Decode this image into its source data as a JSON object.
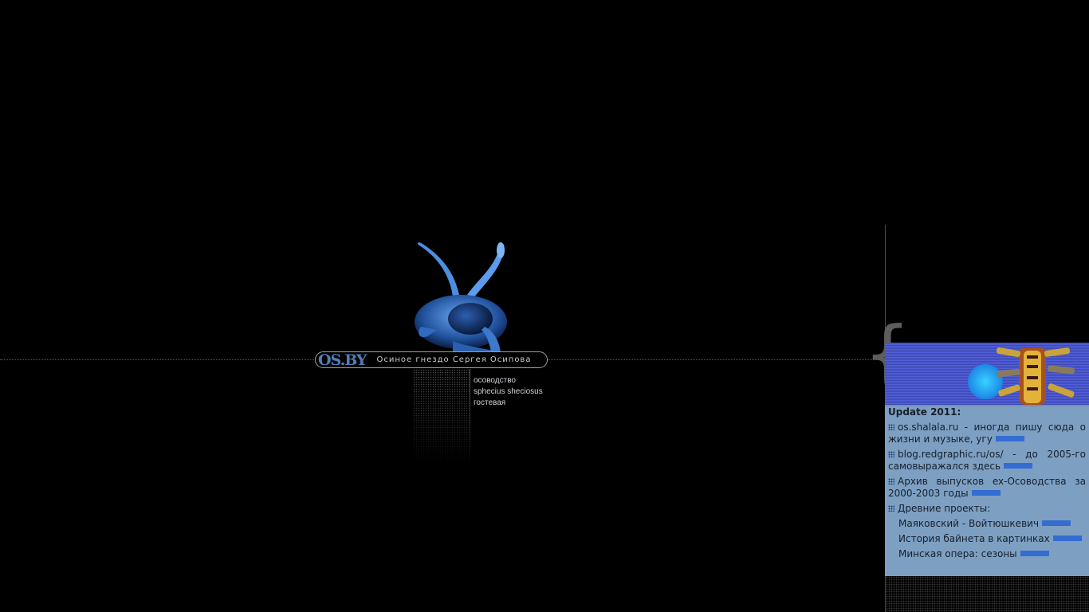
{
  "header": {
    "logo": "OS.BY",
    "tagline": "Осиное гнездо Сергея Осипова"
  },
  "menu": {
    "items": [
      {
        "label": "осоводство"
      },
      {
        "label": "sphecius sheciosus"
      },
      {
        "label": "гостевая"
      }
    ]
  },
  "sidebar": {
    "title": "Update 2011:",
    "entries": [
      {
        "text": "os.shalala.ru - иногда пишу сюда о жизни и музыке, угу"
      },
      {
        "text": "blog.redgraphic.ru/os/ - до 2005-го самовыражался здесь"
      },
      {
        "text": "Архив выпусков ex-Осоводства за 2000-2003 годы"
      }
    ],
    "old_projects_title": "Древние проекты:",
    "old_projects": [
      {
        "label": "Маяковский - Войтюшкевич"
      },
      {
        "label": "История байнета в картинках"
      },
      {
        "label": "Минская опера: сезоны"
      }
    ]
  },
  "colors": {
    "background": "#000000",
    "logo": "#4f7fb6",
    "panel": "#7d9fc2",
    "banner": "#4653c8"
  },
  "icons": {
    "entry_bullet": "dot-grid-icon",
    "link_arrow": "dotted-arrow-icon",
    "wasp": "wasp-image"
  }
}
